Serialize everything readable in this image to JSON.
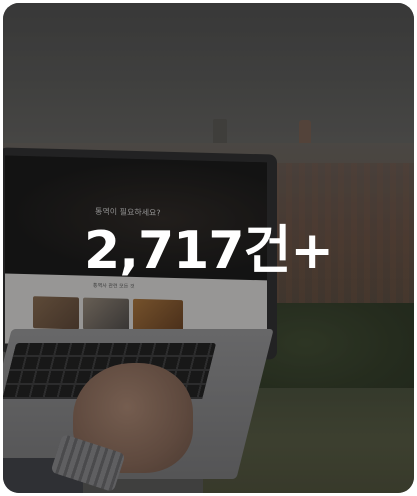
{
  "hero": {
    "count_text": "2,717건+"
  },
  "screen": {
    "headline": "통역이 필요하세요?",
    "section_label": "통역사 관련 모든 것"
  },
  "colors": {
    "overlay": "#141414",
    "text": "#ffffff"
  }
}
